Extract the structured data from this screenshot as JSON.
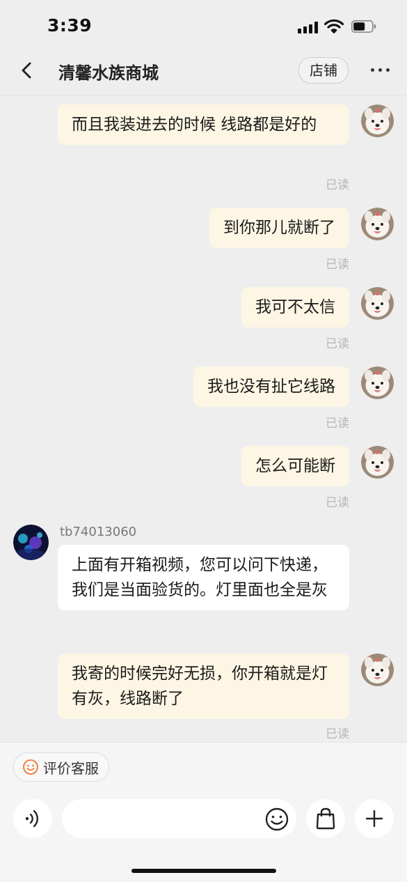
{
  "status_bar": {
    "time": "3:39"
  },
  "header": {
    "title": "清馨水族商城",
    "shop_button": "店铺"
  },
  "messages": [
    {
      "side": "out",
      "text": "而且我装进去的时候  线路都是好的",
      "status": "已读"
    },
    {
      "side": "out",
      "text": "到你那儿就断了",
      "status": "已读"
    },
    {
      "side": "out",
      "text": "我可不太信",
      "status": "已读"
    },
    {
      "side": "out",
      "text": "我也没有扯它线路",
      "status": "已读"
    },
    {
      "side": "out",
      "text": "怎么可能断",
      "status": "已读"
    },
    {
      "side": "in",
      "sender": "tb74013060",
      "text": "上面有开箱视频，您可以问下快递，我们是当面验货的。灯里面也全是灰"
    },
    {
      "side": "out",
      "text": "我寄的时候完好无损，你开箱就是灯有灰，线路断了",
      "status": "已读"
    }
  ],
  "footer": {
    "rate_service": "评价客服",
    "input_placeholder": ""
  },
  "icons": [
    "back-icon",
    "more-icon",
    "smile-icon",
    "voice-icon",
    "emoji-icon",
    "shopping-bag-icon",
    "plus-icon"
  ],
  "colors": {
    "outgoing_bubble": "#fdf6e4",
    "incoming_bubble": "#ffffff",
    "accent_orange": "#f0782a"
  }
}
